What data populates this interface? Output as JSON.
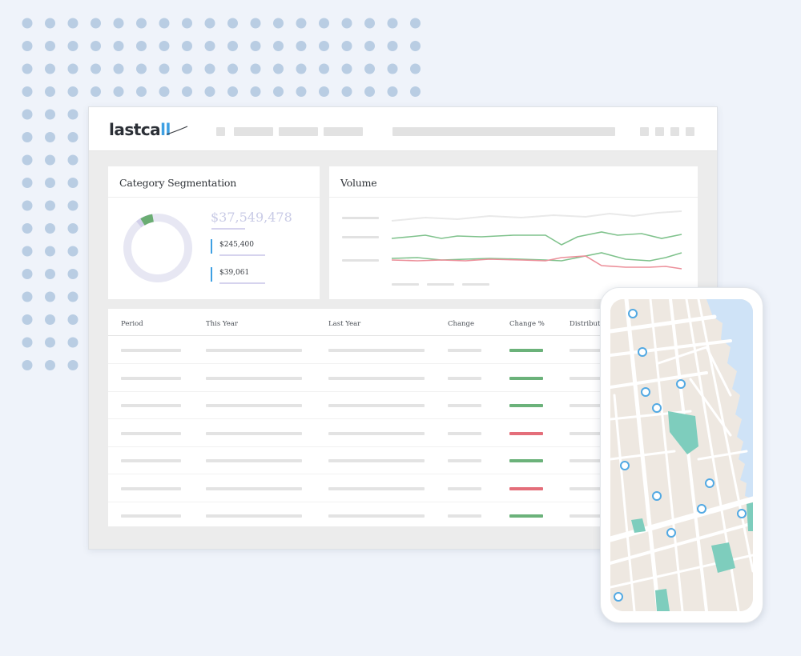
{
  "brand": {
    "logo_main": "lastca",
    "logo_accent": "ll",
    "accent_color": "#3ea0e3"
  },
  "category_card": {
    "title": "Category Segmentation",
    "total": "$37,549,478",
    "items": [
      {
        "value": "$245,400"
      },
      {
        "value": "$39,061"
      }
    ]
  },
  "volume_card": {
    "title": "Volume"
  },
  "table": {
    "columns": [
      "Period",
      "This Year",
      "Last Year",
      "Change",
      "Change %",
      "Distribut"
    ],
    "change_status": [
      "up",
      "up",
      "up",
      "down",
      "up",
      "down",
      "up"
    ]
  },
  "colors": {
    "positive": "#6bb27a",
    "negative": "#e46e7a",
    "map_pin": "#52a9e3",
    "park": "#7ecdbd",
    "water": "#cfe3f7"
  }
}
